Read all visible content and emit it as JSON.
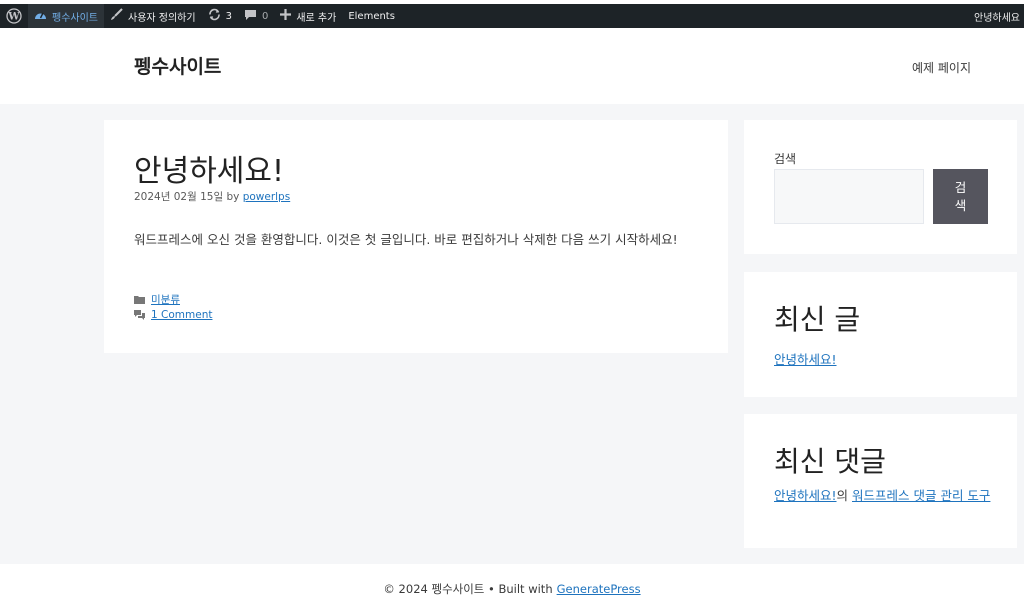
{
  "adminbar": {
    "site_name": "펭수사이트",
    "customize": "사용자 정의하기",
    "updates_count": "3",
    "comments_count": "0",
    "new": "새로 추가",
    "elements": "Elements",
    "greeting": "안녕하세요"
  },
  "header": {
    "site_title": "펭수사이트",
    "nav_item": "예제 페이지"
  },
  "post": {
    "title": "안녕하세요!",
    "date": "2024년 02월 15일",
    "by": "by",
    "author": "powerlps",
    "content": "워드프레스에 오신 것을 환영합니다. 이것은 첫 글입니다. 바로 편집하거나 삭제한 다음 쓰기 시작하세요!",
    "category": "미분류",
    "comments_link": "1 Comment"
  },
  "sidebar": {
    "search_label": "검색",
    "search_button": "검색",
    "recent_posts_title": "최신 글",
    "recent_post": "안녕하세요!",
    "recent_comments_title": "최신 댓글",
    "comment_post": "안녕하세요!",
    "comment_connector": "의",
    "comment_author": "워드프레스 댓글 관리 도구"
  },
  "footer": {
    "copyright": "© 2024 펭수사이트 • Built with",
    "theme_link": "GeneratePress"
  },
  "colors": {
    "adminbar_bg": "#1d2327",
    "link": "#1e73be",
    "button_bg": "#55555e",
    "page_bg": "#f5f6f8"
  }
}
